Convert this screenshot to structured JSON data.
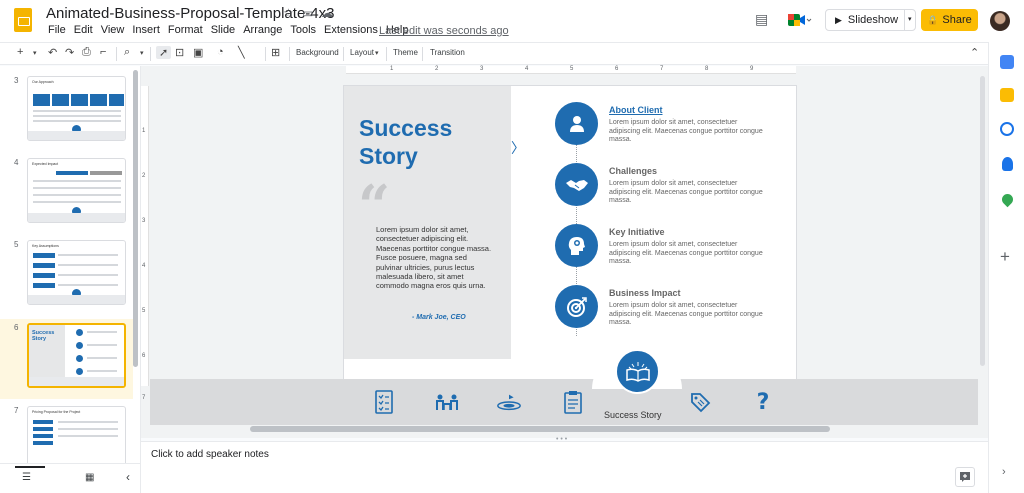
{
  "header": {
    "doc_title": "Animated-Business-Proposal-Template-4x3",
    "menu": [
      "File",
      "Edit",
      "View",
      "Insert",
      "Format",
      "Slide",
      "Arrange",
      "Tools",
      "Extensions",
      "Help"
    ],
    "last_edit": "Last edit was seconds ago",
    "slideshow_label": "Slideshow",
    "share_label": "Share"
  },
  "toolbar": {
    "background_label": "Background",
    "layout_label": "Layout",
    "theme_label": "Theme",
    "transition_label": "Transition"
  },
  "ruler": {
    "h_ticks": [
      "1",
      "2",
      "3",
      "4",
      "5",
      "6",
      "7",
      "8",
      "9"
    ],
    "v_ticks": [
      "1",
      "2",
      "3",
      "4",
      "5",
      "6",
      "7"
    ]
  },
  "filmstrip": {
    "slides": [
      {
        "number": "3",
        "title": "Our Approach",
        "selected": false
      },
      {
        "number": "4",
        "title": "Expected Impact",
        "selected": false
      },
      {
        "number": "5",
        "title": "Key Assumptions",
        "selected": false
      },
      {
        "number": "6",
        "title": "Success Story",
        "selected": true
      },
      {
        "number": "7",
        "title": "Pricing Proposal for the Project",
        "selected": false
      }
    ]
  },
  "slide": {
    "title_line1": "Success",
    "title_line2": "Story",
    "quote": "Lorem ipsum dolor sit amet, consectetuer adipiscing elit. Maecenas porttitor congue massa. Fusce posuere, magna sed pulvinar ultricies, purus lectus malesuada libero, sit amet commodo magna eros quis urna.",
    "quote_author": "- Mark Joe, CEO",
    "items": [
      {
        "title": "About Client",
        "text": "Lorem ipsum dolor sit amet, consectetuer adipiscing elit. Maecenas congue porttitor congue massa.",
        "icon": "person-icon"
      },
      {
        "title": "Challenges",
        "text": "Lorem ipsum dolor sit amet, consectetuer adipiscing elit. Maecenas congue porttitor congue massa.",
        "icon": "handshake-icon"
      },
      {
        "title": "Key Initiative",
        "text": "Lorem ipsum dolor sit amet, consectetuer adipiscing elit. Maecenas congue porttitor congue massa.",
        "icon": "idea-head-icon"
      },
      {
        "title": "Business Impact",
        "text": "Lorem ipsum dolor sit amet, consectetuer adipiscing elit. Maecenas congue porttitor congue massa.",
        "icon": "target-icon"
      }
    ],
    "nav_label": "Success Story",
    "accent_color": "#1f6cb0"
  },
  "notes": {
    "placeholder": "Click to add speaker notes"
  }
}
